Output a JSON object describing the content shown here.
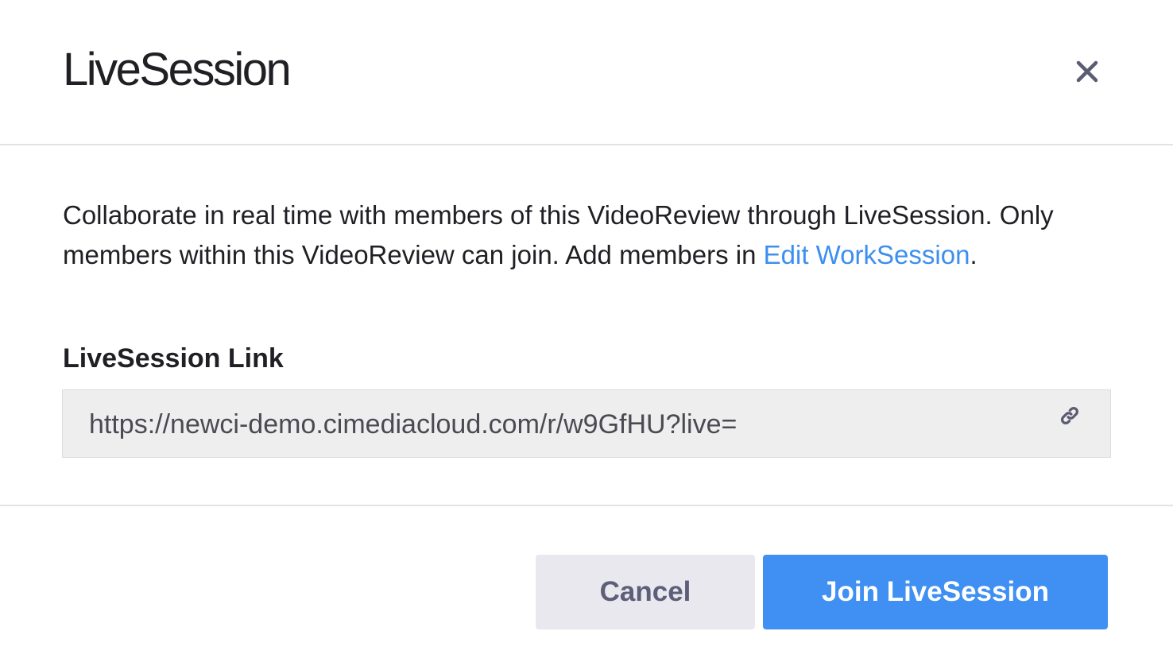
{
  "modal": {
    "title": "LiveSession",
    "close_icon": "close-icon"
  },
  "body": {
    "description_text": "Collaborate in real time with members of this VideoReview through LiveSession. Only members within this VideoReview can join. Add members in ",
    "description_link": "Edit WorkSession",
    "description_end": ".",
    "link_label": "LiveSession Link",
    "link_value": "https://newci-demo.cimediacloud.com/r/w9GfHU?live=",
    "link_icon": "link-icon"
  },
  "footer": {
    "cancel_label": "Cancel",
    "join_label": "Join LiveSession"
  },
  "colors": {
    "accent": "#3f90f2",
    "link": "#3d8fef",
    "cancel_bg": "#e8e8ee",
    "cancel_text": "#5e5e7a",
    "field_bg": "#eeeeee"
  }
}
